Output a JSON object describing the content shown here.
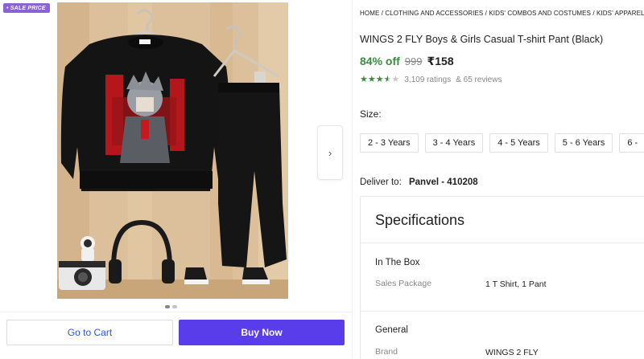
{
  "badge": {
    "text": "• SALE PRICE"
  },
  "gallery": {
    "next_icon": "chevron-right-icon",
    "next_glyph": "›",
    "dots": [
      true,
      false
    ]
  },
  "actions": {
    "cart_label": "Go to Cart",
    "buy_label": "Buy Now",
    "buy_color": "#5a3dea"
  },
  "breadcrumb": "HOME / CLOTHING AND ACCESSORIES / KIDS' COMBOS AND COSTUMES / KIDS' APPAREL COMB",
  "product": {
    "title": "WINGS 2 FLY Boys & Girls Casual T-shirt Pant  (Black)",
    "discount": "84% off",
    "mrp": "999",
    "price": "₹158",
    "rating_stars": 3.5,
    "ratings_text": "3,109 ratings",
    "reviews_text": "& 65 reviews"
  },
  "size": {
    "label": "Size:",
    "options": [
      "2 - 3 Years",
      "3 - 4 Years",
      "4 - 5 Years",
      "5 - 6 Years",
      "6 -"
    ]
  },
  "delivery": {
    "label": "Deliver to:",
    "value": "Panvel - 410208"
  },
  "specifications": {
    "title": "Specifications",
    "groups": [
      {
        "name": "In The Box",
        "rows": [
          {
            "key": "Sales Package",
            "value": "1 T Shirt, 1 Pant"
          }
        ]
      },
      {
        "name": "General",
        "rows": [
          {
            "key": "Brand",
            "value": "WINGS 2 FLY"
          }
        ]
      }
    ]
  },
  "colors": {
    "green": "#388e3c",
    "badge": "#8a63d2",
    "link_blue": "#2a55e5"
  }
}
